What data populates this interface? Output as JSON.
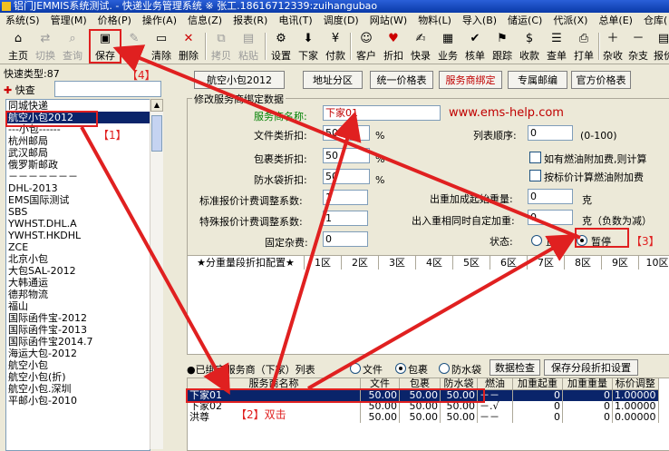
{
  "title": "铝门JEMMIS系统测试.  - 快递业务管理系统  ※ 张工.18616712339:zuihangubao",
  "menu": [
    "系统(S)",
    "管理(M)",
    "价格(P)",
    "操作(A)",
    "信息(Z)",
    "报表(R)",
    "电讯(T)",
    "调度(D)",
    "网站(W)",
    "物料(L)",
    "导入(B)",
    "储运(C)",
    "代派(X)",
    "总单(E)",
    "仓库("
  ],
  "toolbar": [
    "主页",
    "切换",
    "查询",
    "保存",
    "修",
    "清除",
    "删除",
    "拷贝",
    "粘贴",
    "设置",
    "下家",
    "付款",
    "客户",
    "折扣",
    "快录",
    "业务",
    "核单",
    "跟踪",
    "收款",
    "查单",
    "打单",
    "杂收",
    "杂支",
    "报价"
  ],
  "left": {
    "quick_type": "快速类型:87",
    "quick_search": "快查",
    "items": [
      "同城快递",
      "航空小包2012",
      "---小包------",
      "杭州邮局",
      "武汉邮局",
      "俄罗斯邮政",
      "－－－－－－－",
      "DHL-2013",
      "EMS国际测试",
      "SBS",
      "YWHST.DHL.A",
      "YWHST.HKDHL",
      "ZCE",
      "北京小包",
      "大包SAL-2012",
      "大韩通运",
      "德邦物流",
      "福山",
      "国际函件宝-2012",
      "国际函件宝-2013",
      "国际函件宝2014.7",
      "海运大包-2012",
      "航空小包",
      "航空小包(折)",
      "航空小包.深圳",
      "平邮小包-2010"
    ]
  },
  "tabs": [
    "航空小包2012",
    "地址分区",
    "统一价格表",
    "服务商绑定",
    "专属邮编",
    "官方价格表"
  ],
  "form": {
    "group_title": "修改服务商绑定数据",
    "provider_label": "服务商名称:",
    "provider_value": "下家01",
    "website": "www.ems-help.com",
    "file_label": "文件类折扣:",
    "file_value": "50",
    "pct1": "%",
    "order_label": "列表顺序:",
    "order_value": "0",
    "order_hint": "(0-100)",
    "pkg_label": "包裹类折扣:",
    "pkg_value": "50",
    "pct2": "%",
    "fuel_check": "如有燃油附加费,则计算",
    "bag_label": "防水袋折扣:",
    "bag_value": "50",
    "pct3": "%",
    "fuel_price_check": "按标价计算燃油附加费",
    "std_label": "标准报价计费调整系数:",
    "std_value": "1",
    "overweight_label": "出重加成起始重量:",
    "overweight_value": "0",
    "unit_g": "克",
    "spec_label": "特殊报价计费调整系数:",
    "spec_value": "1",
    "inout_label": "出入重相同时自定加重:",
    "inout_value": "0",
    "inout_unit": "克（负数为减）",
    "fixed_label": "固定杂费:",
    "fixed_value": "0",
    "status_label": "状态:",
    "status_normal": "正常",
    "status_pause": "暂停"
  },
  "zone_header": [
    "★分重量段折扣配置★",
    "1区",
    "2区",
    "3区",
    "4区",
    "5区",
    "6区",
    "7区",
    "8区",
    "9区",
    "10区"
  ],
  "bind_bar": {
    "title": "●已绑定服务商（下家）列表",
    "r_file": "文件",
    "r_pkg": "包裹",
    "r_bag": "防水袋",
    "btn_check": "数据检查",
    "btn_save": "保存分段折扣设置"
  },
  "grid": {
    "headers": [
      "服务商名称",
      "文件",
      "包裹",
      "防水袋",
      "燃油",
      "加重起重",
      "加重重量",
      "标价调整"
    ],
    "rows": [
      [
        "下家01",
        "50.00",
        "50.00",
        "50.00",
        "－－",
        "0",
        "0",
        "1.00000"
      ],
      [
        "下家02",
        "50.00",
        "50.00",
        "50.00",
        "－.√",
        "0",
        "0",
        "1.00000"
      ],
      [
        "洪尊",
        "50.00",
        "50.00",
        "50.00",
        "－－",
        "0",
        "0",
        "0.00000"
      ]
    ]
  },
  "annotations": {
    "a1": "【1】",
    "a2": "【2】双击",
    "a3": "【3】",
    "a4": "【4】"
  },
  "colors": {
    "annotation": "#e02020",
    "selected": "#0a246a",
    "provider_label": "#008000"
  }
}
